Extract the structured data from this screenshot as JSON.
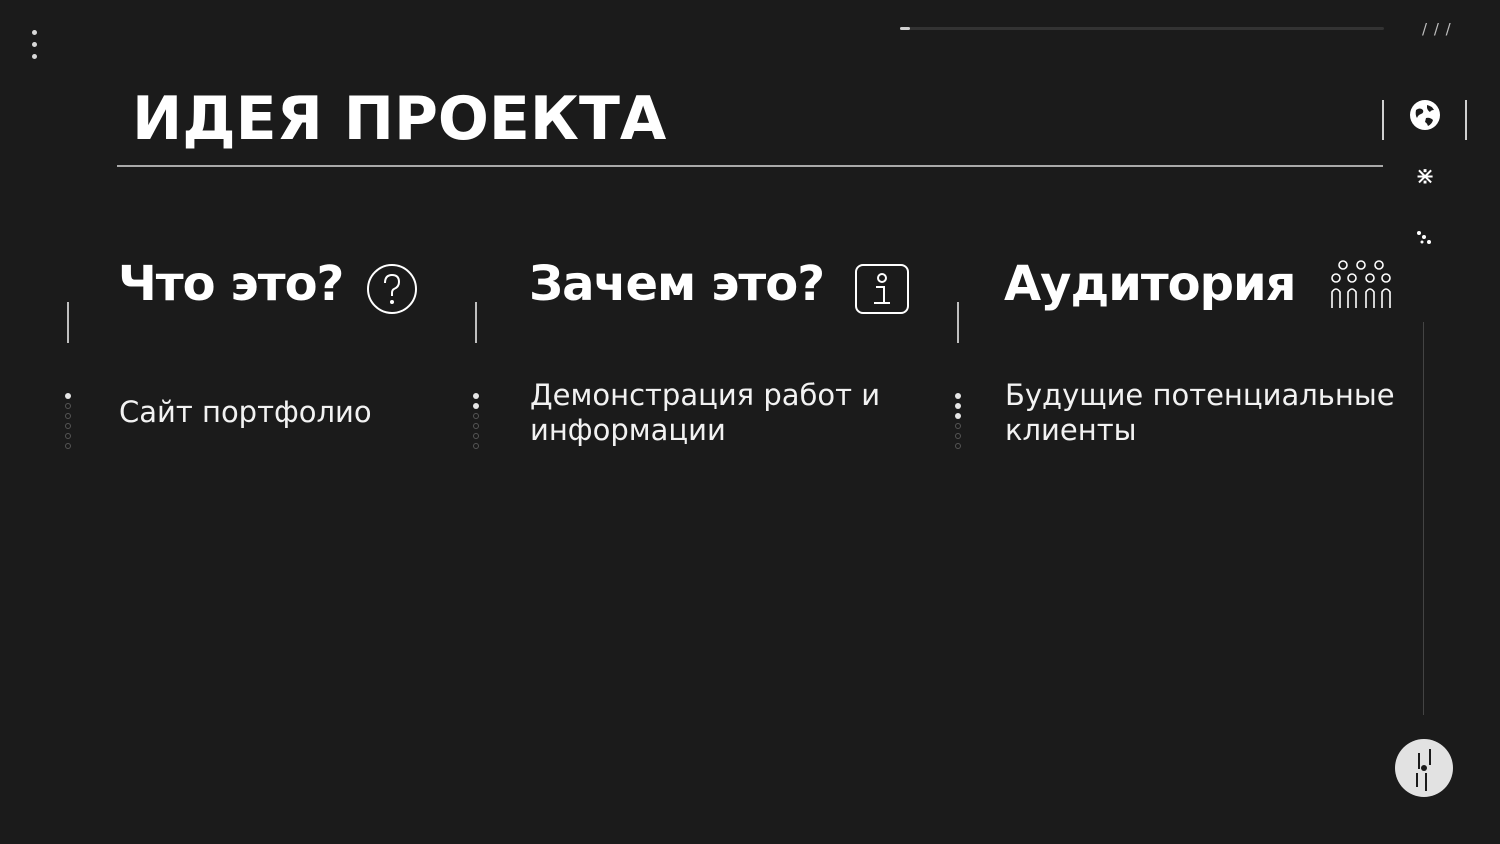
{
  "header": {
    "title": "ИДЕЯ ПРОЕКТА",
    "progress": 0.02
  },
  "columns": [
    {
      "heading": "Что это?",
      "text": "Сайт портфолио",
      "icon": "question-circle-icon",
      "bullets_active": 1
    },
    {
      "heading": "Зачем это?",
      "text": "Демонстрация работ и информации",
      "icon": "info-square-icon",
      "bullets_active": 2
    },
    {
      "heading": "Аудитория",
      "text": "Будущие потенциальные клиенты",
      "icon": "people-group-icon",
      "bullets_active": 3
    }
  ],
  "sidebar": {
    "icons": [
      "globe-icon",
      "asterisk-icon",
      "dots-cluster-icon"
    ],
    "nav_knob": "navigation-knob"
  },
  "colors": {
    "background": "#1b1b1b",
    "text": "#ffffff",
    "accent": "#e2e2e2"
  }
}
